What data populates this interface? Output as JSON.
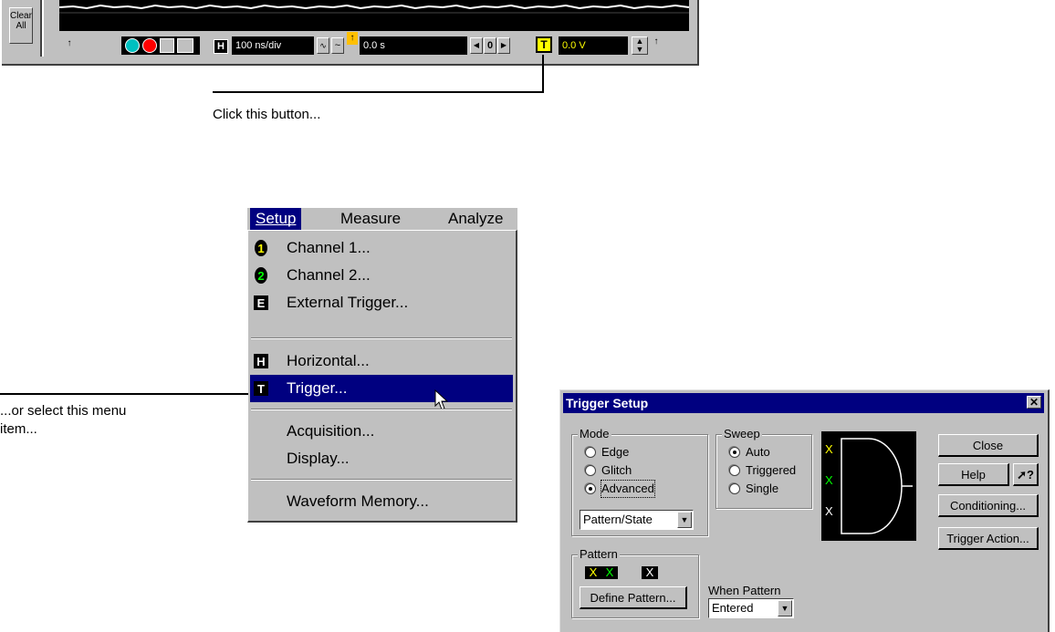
{
  "toolbar": {
    "clear_all": "Clear\nAll",
    "timebase_label": "H",
    "timebase_value": "100 ns/div",
    "delay_value": "0.0 s",
    "nav_left": "◀",
    "nav_center": "0",
    "nav_right": "▶",
    "trigger_label": "T",
    "trigger_level": "0.0 V"
  },
  "callouts": {
    "click_button": "Click this button...",
    "select_menu_line1": "...or select this menu",
    "select_menu_line2": "item..."
  },
  "menubar": {
    "items": [
      "Setup",
      "Measure",
      "Analyze"
    ]
  },
  "menu": {
    "items": [
      {
        "label": "Channel 1...",
        "icon": "channel-1-icon",
        "badge": "1",
        "badge_color": "#ffff00"
      },
      {
        "label": "Channel 2...",
        "icon": "channel-2-icon",
        "badge": "2",
        "badge_color": "#00ff00"
      },
      {
        "label": "External Trigger...",
        "icon": "external-trigger-icon",
        "badge": "E"
      },
      {
        "label": "Horizontal...",
        "icon": "horizontal-icon",
        "badge": "H"
      },
      {
        "label": "Trigger...",
        "icon": "trigger-icon",
        "badge": "T",
        "highlighted": true
      },
      {
        "label": "Acquisition..."
      },
      {
        "label": "Display..."
      },
      {
        "label": "Waveform Memory..."
      }
    ]
  },
  "dialog": {
    "title": "Trigger Setup",
    "mode": {
      "label": "Mode",
      "options": [
        "Edge",
        "Glitch",
        "Advanced"
      ],
      "selected": "Advanced",
      "select_value": "Pattern/State"
    },
    "sweep": {
      "label": "Sweep",
      "options": [
        "Auto",
        "Triggered",
        "Single"
      ],
      "selected": "Auto"
    },
    "pattern": {
      "label": "Pattern",
      "bits": [
        "X",
        "X",
        "X"
      ],
      "define_button": "Define Pattern..."
    },
    "when_pattern": {
      "label": "When Pattern",
      "value": "Entered"
    },
    "gate_inputs": [
      "X",
      "X",
      "X"
    ],
    "buttons": {
      "close": "Close",
      "help": "Help",
      "help_pointer": "?",
      "conditioning": "Conditioning...",
      "trigger_action": "Trigger Action..."
    }
  },
  "colors": {
    "menu_highlight": "#000080",
    "channel1": "#ffff00",
    "channel2": "#00ff00",
    "window_face": "#c0c0c0"
  }
}
